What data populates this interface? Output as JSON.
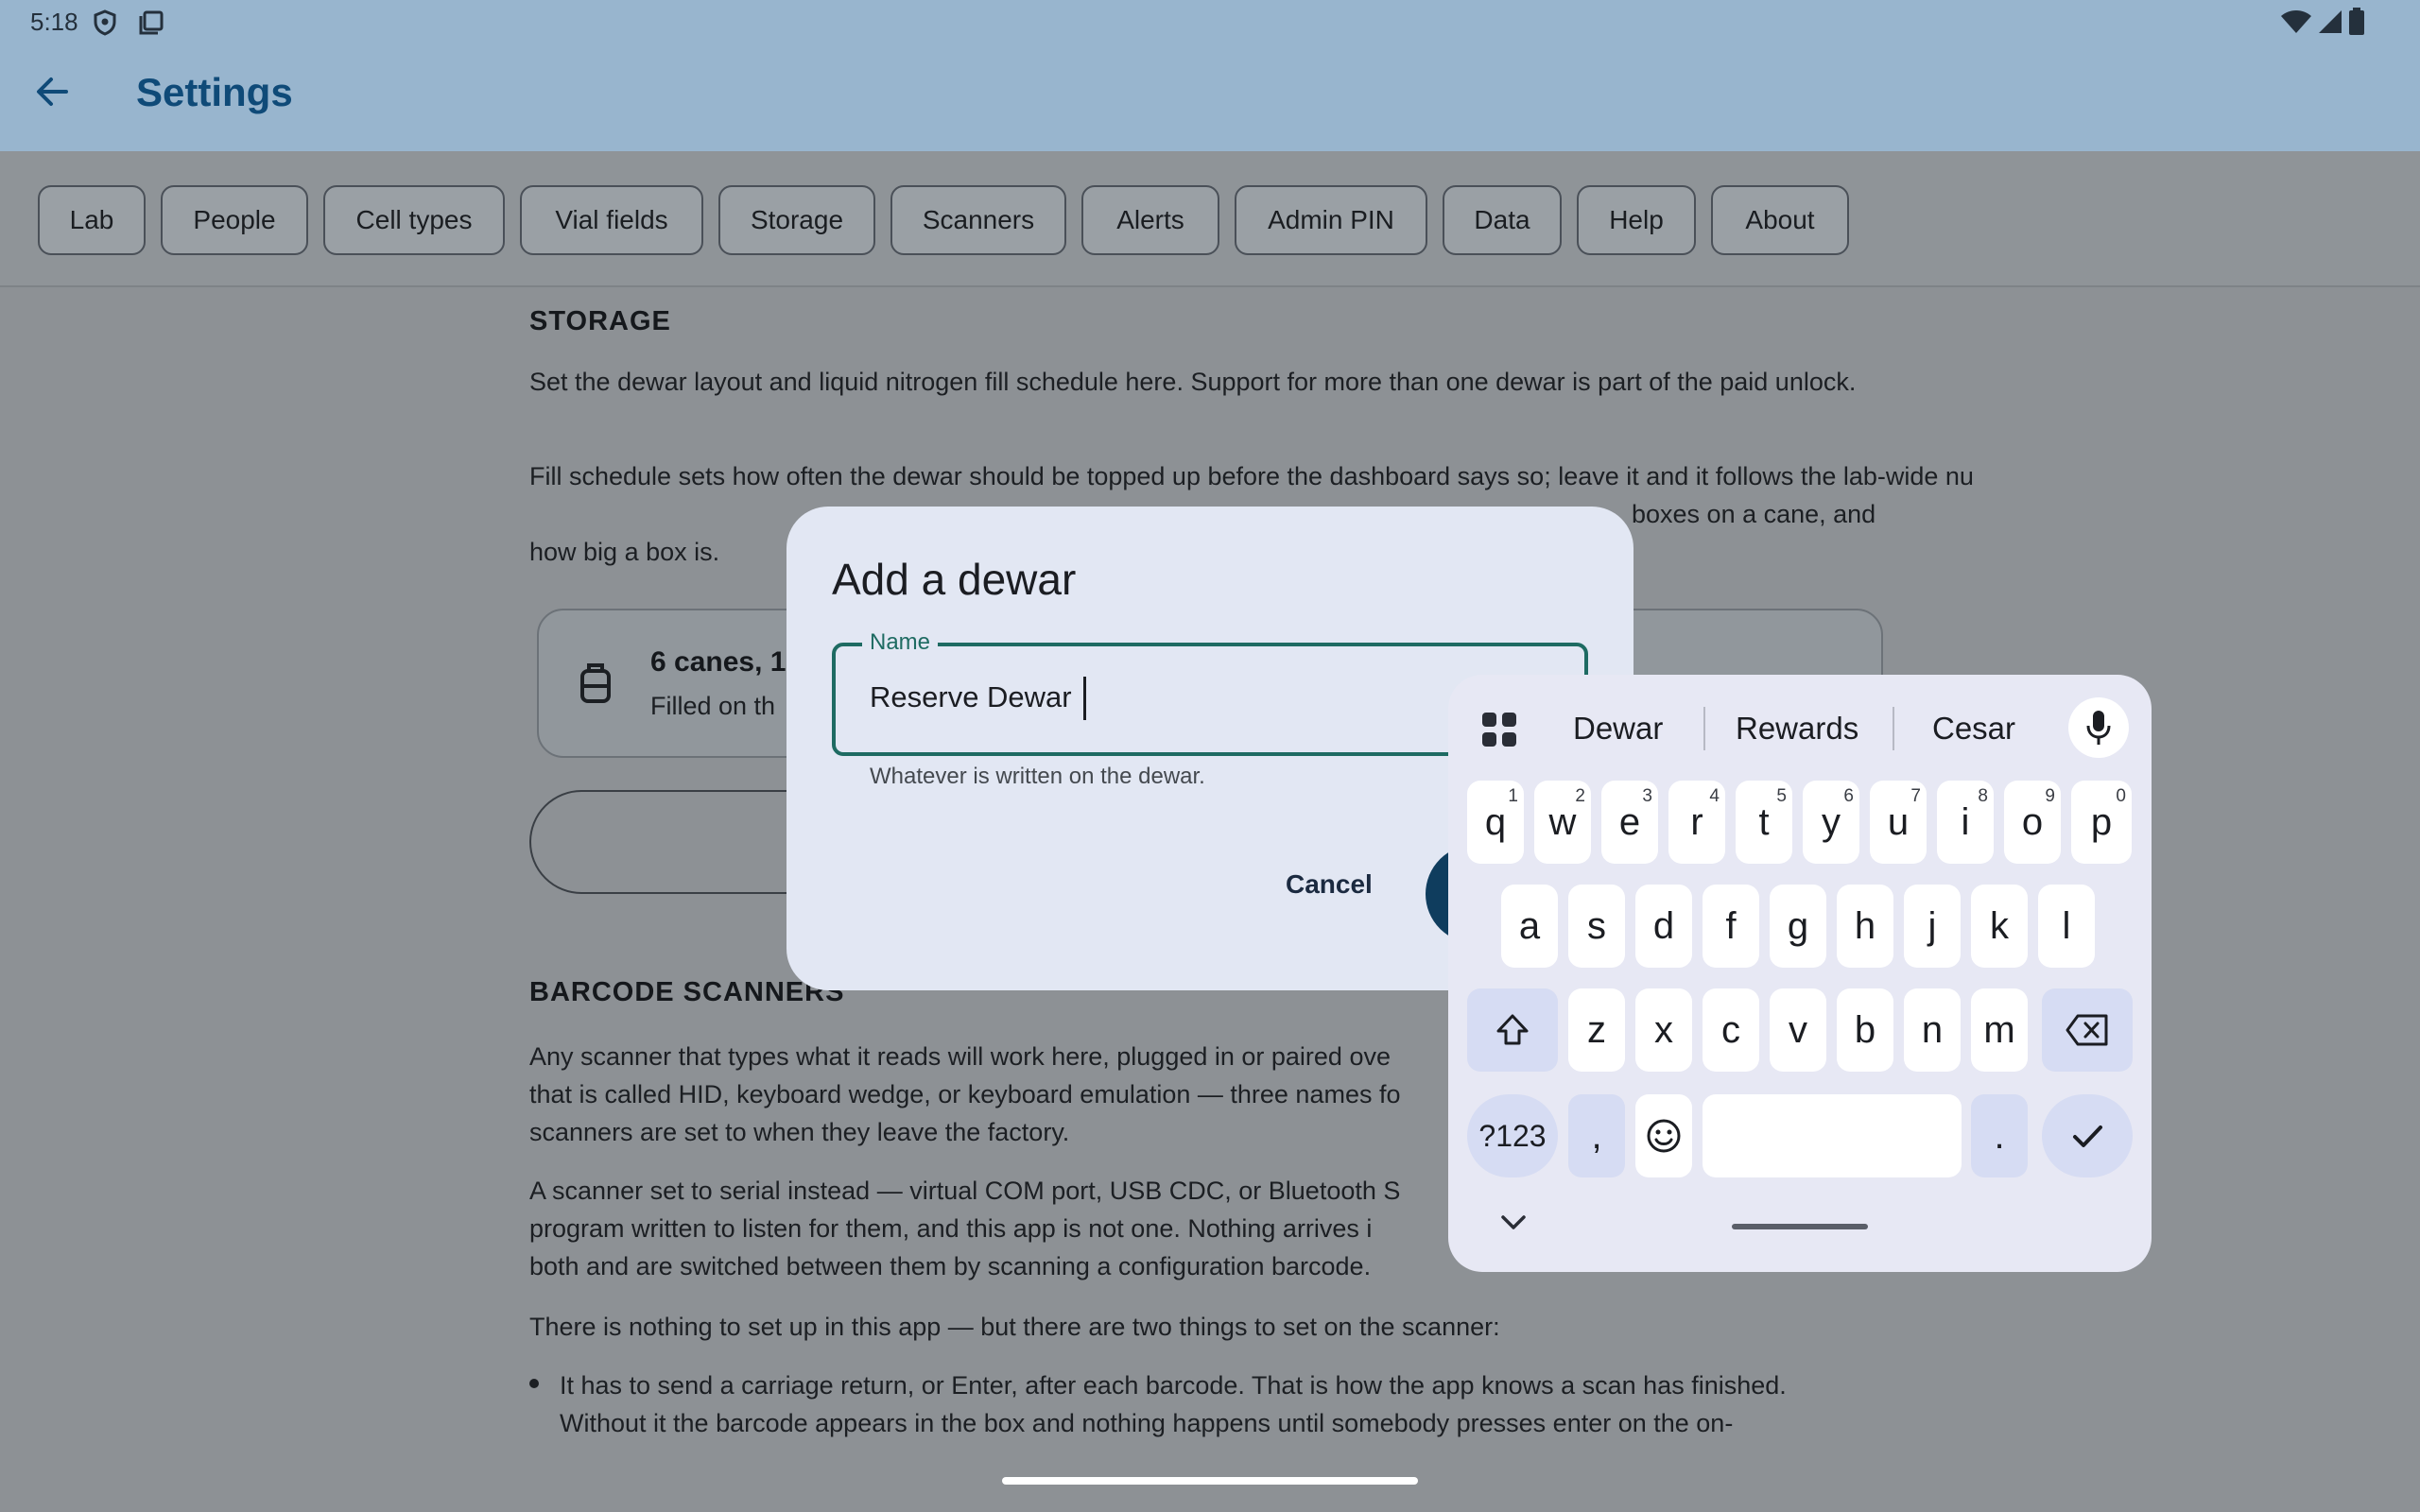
{
  "status": {
    "time": "5:18"
  },
  "app": {
    "title": "Settings"
  },
  "tabs": [
    "Lab",
    "People",
    "Cell types",
    "Vial fields",
    "Storage",
    "Scanners",
    "Alerts",
    "Admin PIN",
    "Data",
    "Help",
    "About"
  ],
  "storage": {
    "heading": "STORAGE",
    "para1": "Set the dewar layout and liquid nitrogen fill schedule here. Support for more than one dewar is part of the paid unlock.",
    "para2": "Fill schedule sets how often the dewar should be topped up before the dashboard says so; leave it and it follows the lab-wide nu",
    "para2_cont": "boxes on a cane, and",
    "para2_end": "how big a box is.",
    "card_title": "6 canes, 1",
    "card_sub": "Filled on th"
  },
  "scanners": {
    "heading": "BARCODE SCANNERS",
    "p1_l1": "Any scanner that types what it reads will work here, plugged in or paired ove",
    "p1_l2": "that is called HID, keyboard wedge, or keyboard emulation — three names fo",
    "p1_l3": "scanners are set to when they leave the factory.",
    "p2_l1": "A scanner set to serial instead — virtual COM port, USB CDC, or Bluetooth S",
    "p2_l2": "program written to listen for them, and this app is not one. Nothing arrives i",
    "p2_l3": "both and are switched between them by scanning a configuration barcode.",
    "p3": "There is nothing to set up in this app — but there are two things to set on the scanner:",
    "bullet1_l1": "It has to send a carriage return, or Enter, after each barcode. That is how the app knows a scan has finished.",
    "bullet1_l2": "Without it the barcode appears in the box and nothing happens until somebody presses enter on the on-"
  },
  "dialog": {
    "title": "Add a dewar",
    "field_label": "Name",
    "field_value": "Reserve Dewar",
    "helper": "Whatever is written on the dewar.",
    "cancel": "Cancel"
  },
  "keyboard": {
    "suggestions": [
      "Dewar",
      "Rewards",
      "Cesar"
    ],
    "row1": [
      {
        "k": "q",
        "h": "1"
      },
      {
        "k": "w",
        "h": "2"
      },
      {
        "k": "e",
        "h": "3"
      },
      {
        "k": "r",
        "h": "4"
      },
      {
        "k": "t",
        "h": "5"
      },
      {
        "k": "y",
        "h": "6"
      },
      {
        "k": "u",
        "h": "7"
      },
      {
        "k": "i",
        "h": "8"
      },
      {
        "k": "o",
        "h": "9"
      },
      {
        "k": "p",
        "h": "0"
      }
    ],
    "row2": [
      "a",
      "s",
      "d",
      "f",
      "g",
      "h",
      "j",
      "k",
      "l"
    ],
    "row3": [
      "z",
      "x",
      "c",
      "v",
      "b",
      "n",
      "m"
    ],
    "symbols": "?123",
    "comma": ",",
    "period": "."
  }
}
